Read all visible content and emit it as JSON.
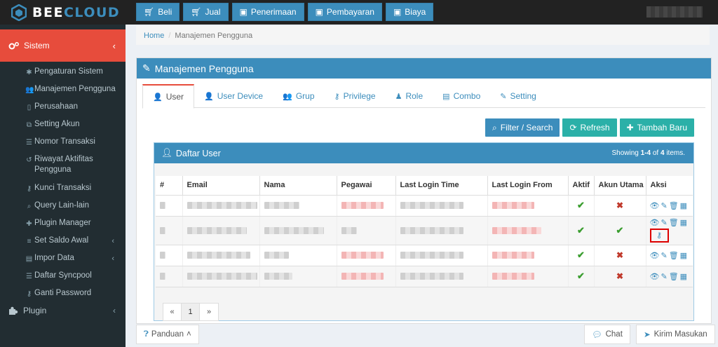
{
  "brand": {
    "part1": "BEE",
    "part2": "CLOUD"
  },
  "topnav": [
    {
      "label": "Beli",
      "icon": "cart-icon"
    },
    {
      "label": "Jual",
      "icon": "cart-icon"
    },
    {
      "label": "Penerimaan",
      "icon": "money-icon"
    },
    {
      "label": "Pembayaran",
      "icon": "money-icon"
    },
    {
      "label": "Biaya",
      "icon": "money-icon"
    }
  ],
  "sidebar": {
    "section": "Sistem",
    "items": [
      {
        "label": "Pengaturan Sistem",
        "icon": "✱"
      },
      {
        "label": "Manajemen Pengguna",
        "icon": "👥"
      },
      {
        "label": "Perusahaan",
        "icon": "▯"
      },
      {
        "label": "Setting Akun",
        "icon": "⧉"
      },
      {
        "label": "Nomor Transaksi",
        "icon": "☰"
      },
      {
        "label": "Riwayat Aktifitas Pengguna",
        "icon": "↺"
      },
      {
        "label": "Kunci Transaksi",
        "icon": "⚷"
      },
      {
        "label": "Query Lain-lain",
        "icon": "⌕"
      },
      {
        "label": "Plugin Manager",
        "icon": "✚"
      },
      {
        "label": "Set Saldo Awal",
        "icon": "≡"
      },
      {
        "label": "Impor Data",
        "icon": "▤"
      },
      {
        "label": "Daftar Syncpool",
        "icon": "☰"
      },
      {
        "label": "Ganti Password",
        "icon": "⚷"
      }
    ],
    "plugin": "Plugin"
  },
  "breadcrumb": {
    "home": "Home",
    "sep": "/",
    "current": "Manajemen Pengguna"
  },
  "panel": {
    "title": "Manajemen Pengguna"
  },
  "tabs": [
    {
      "label": "User",
      "icon": "👤"
    },
    {
      "label": "User Device",
      "icon": "👤"
    },
    {
      "label": "Grup",
      "icon": "👥"
    },
    {
      "label": "Privilege",
      "icon": "⚷"
    },
    {
      "label": "Role",
      "icon": "♟"
    },
    {
      "label": "Combo",
      "icon": "▤"
    },
    {
      "label": "Setting",
      "icon": "✎"
    }
  ],
  "actions": {
    "filter": "Filter / Search",
    "refresh": "Refresh",
    "add": "Tambah Baru"
  },
  "list": {
    "title": "Daftar User",
    "showing_pre": "Showing ",
    "showing_range": "1-4",
    "showing_mid": " of ",
    "showing_total": "4",
    "showing_post": " items."
  },
  "table": {
    "headers": [
      "#",
      "Email",
      "Nama",
      "Pegawai",
      "Last Login Time",
      "Last Login From",
      "Aktif",
      "Akun Utama",
      "Aksi"
    ],
    "rows": [
      {
        "aktif": "✔",
        "utama": "✖"
      },
      {
        "aktif": "✔",
        "utama": "✔"
      },
      {
        "aktif": "✔",
        "utama": "✖"
      },
      {
        "aktif": "✔",
        "utama": "✖"
      }
    ]
  },
  "pager": {
    "prev": "«",
    "page": "1",
    "next": "»"
  },
  "footer": {
    "guide": "Panduan",
    "chat": "Chat",
    "send": "Kirim Masukan"
  }
}
